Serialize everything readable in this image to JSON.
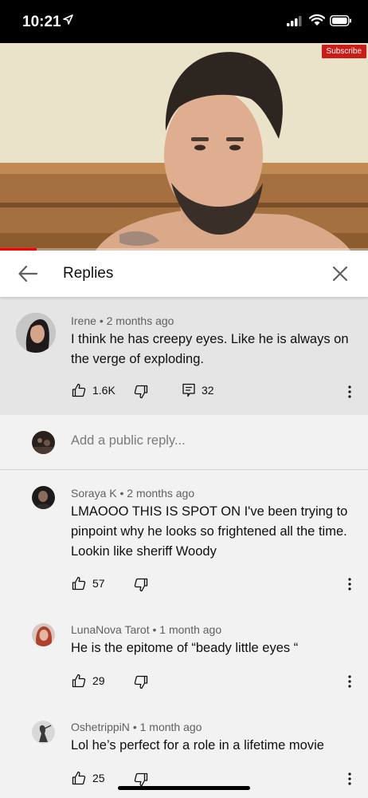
{
  "status_bar": {
    "time": "10:21"
  },
  "video": {
    "subscribe_label": "Subscribe",
    "progress": 0.1
  },
  "header": {
    "title": "Replies"
  },
  "parent_comment": {
    "author": "Irene",
    "age": "2 months ago",
    "text": "I think he has creepy eyes. Like he is always on the verge of exploding.",
    "likes": "1.6K",
    "replies": "32"
  },
  "add_reply": {
    "placeholder": "Add a public reply..."
  },
  "replies": [
    {
      "author": "Soraya K",
      "age": "2 months ago",
      "text": "LMAOOO THIS IS SPOT ON I've been trying to pinpoint why he looks so frightened all the time. Lookin like sheriff Woody",
      "likes": "57"
    },
    {
      "author": "LunaNova Tarot",
      "age": "1 month ago",
      "text": "He is the epitome of “beady little eyes “",
      "likes": "29"
    },
    {
      "author": "OshetrippiN",
      "age": "1 month ago",
      "text": "Lol he’s perfect for a role in a lifetime movie",
      "likes": "25"
    }
  ],
  "separator": "•"
}
